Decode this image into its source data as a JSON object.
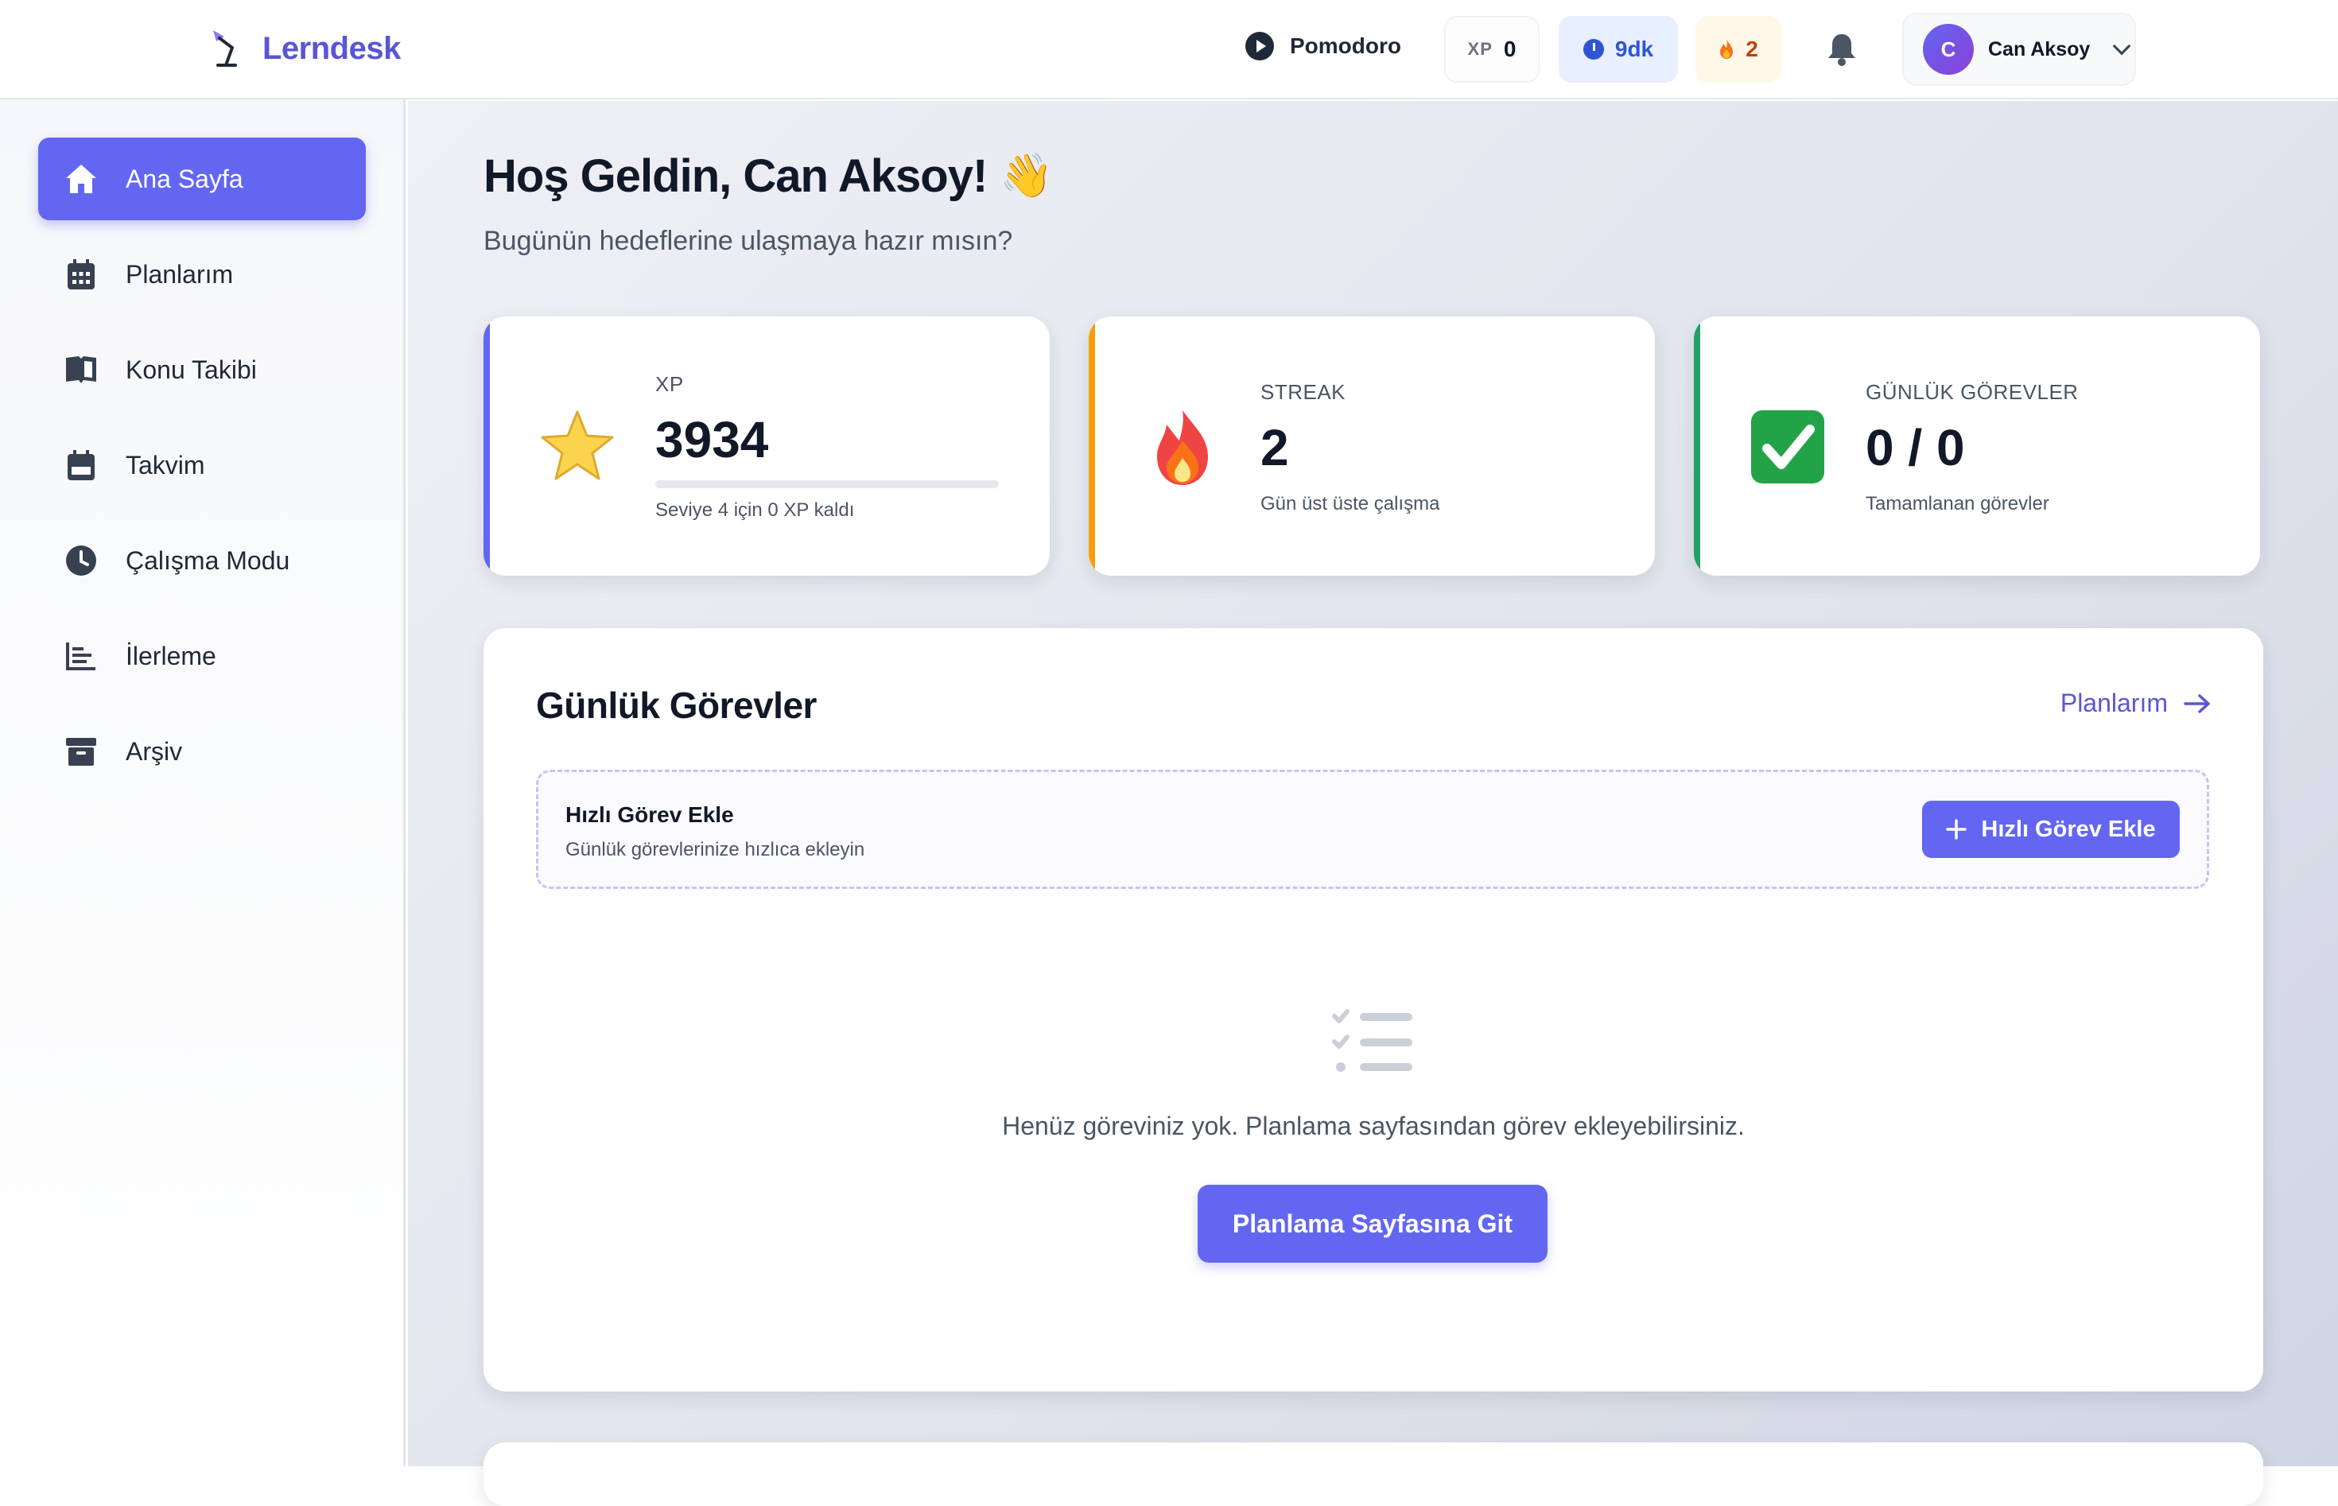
{
  "brand": {
    "name": "Lerndesk",
    "logo": "lamp-logo-icon"
  },
  "topbar": {
    "pomodoro_label": "Pomodoro",
    "xp_key": "XP",
    "xp_value": "0",
    "study_time": "9dk",
    "streak": "2",
    "notifications_icon": "bell-icon",
    "user": {
      "initial": "C",
      "name": "Can Aksoy"
    }
  },
  "sidebar": {
    "items": [
      {
        "label": "Ana Sayfa",
        "icon": "home-icon",
        "active": true
      },
      {
        "label": "Planlarım",
        "icon": "calendar-grid-icon"
      },
      {
        "label": "Konu Takibi",
        "icon": "book-icon"
      },
      {
        "label": "Takvim",
        "icon": "calendar-icon"
      },
      {
        "label": "Çalışma Modu",
        "icon": "clock-icon"
      },
      {
        "label": "İlerleme",
        "icon": "bar-chart-icon"
      },
      {
        "label": "Arşiv",
        "icon": "archive-icon"
      }
    ]
  },
  "main": {
    "greeting": "Hoş Geldin, Can Aksoy!",
    "greeting_emoji": "👋",
    "subtitle": "Bugünün hedeflerine ulaşmaya hazır mısın?",
    "stats": [
      {
        "label": "XP",
        "value": "3934",
        "caption": "Seviye 4 için 0 XP kaldı",
        "progress": 0,
        "accent": "#6366f1",
        "emoji": "star-icon"
      },
      {
        "label": "STREAK",
        "value": "2",
        "caption": "Gün üst üste çalışma",
        "accent": "#f59e0b",
        "emoji": "fire-icon"
      },
      {
        "label": "GÜNLÜK GÖREVLER",
        "value": "0 / 0",
        "caption": "Tamamlanan görevler",
        "accent": "#22a06b",
        "emoji": "check-box-icon"
      }
    ],
    "tasks_panel": {
      "title": "Günlük Görevler",
      "link_label": "Planlarım",
      "quick_add": {
        "title": "Hızlı Görev Ekle",
        "subtitle": "Günlük görevlerinize hızlıca ekleyin",
        "button": "Hızlı Görev Ekle"
      },
      "empty_text": "Henüz göreviniz yok. Planlama sayfasından görev ekleyebilirsiniz.",
      "cta": "Planlama Sayfasına Git"
    }
  },
  "colors": {
    "accent": "#6366f1",
    "brand": "#5a55d6",
    "time_chip": "#2f55d4",
    "streak_chip": "#c2410c"
  }
}
